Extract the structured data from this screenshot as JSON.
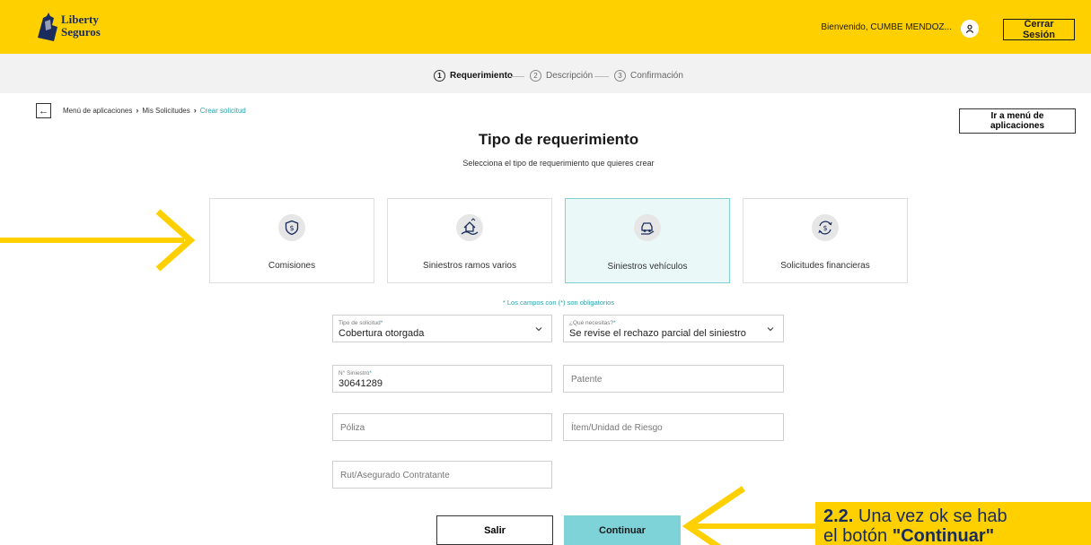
{
  "header": {
    "logo_line1": "Liberty",
    "logo_line2": "Seguros",
    "welcome": "Bienvenido, CUMBE MENDOZ...",
    "logout": "Cerrar Sesión"
  },
  "stepper": [
    {
      "num": "1",
      "label": "Requerimiento"
    },
    {
      "num": "2",
      "label": "Descripción"
    },
    {
      "num": "3",
      "label": "Confirmación"
    }
  ],
  "breadcrumb": {
    "back": "←",
    "items": [
      "Menú de aplicaciones",
      "Mis Solicitudes",
      "Crear solicitud"
    ],
    "sep": "›"
  },
  "goto_button": "Ir a menú de aplicaciones",
  "page": {
    "title": "Tipo de requerimiento",
    "subtitle": "Selecciona el tipo de requerimiento que quieres crear"
  },
  "cards": [
    {
      "label": "Comisiones",
      "icon": "shield-dollar-icon"
    },
    {
      "label": "Siniestros ramos varios",
      "icon": "house-hand-icon"
    },
    {
      "label": "Siniestros vehículos",
      "icon": "car-hand-icon"
    },
    {
      "label": "Solicitudes financieras",
      "icon": "dollar-cycle-icon"
    }
  ],
  "required_note": "* Los campos con (*) son obligatorios",
  "form": {
    "tipo_solicitud": {
      "label": "Tipo de solicitud",
      "ast": "*",
      "value": "Cobertura otorgada"
    },
    "que_necesitas": {
      "label": "¿Qué necesitas?",
      "ast": "*",
      "value": "Se revise el rechazo parcial del siniestro"
    },
    "siniestro": {
      "label": "N° Siniestro",
      "ast": "*",
      "value": "30641289"
    },
    "patente": {
      "placeholder": "Patente"
    },
    "poliza": {
      "placeholder": "Póliza"
    },
    "item": {
      "placeholder": "Ítem/Unidad de Riesgo"
    },
    "rut": {
      "placeholder": "Rut/Asegurado Contratante"
    }
  },
  "buttons": {
    "exit": "Salir",
    "continue": "Continuar"
  },
  "annotation": {
    "num": "2.2.",
    "line1": " Una vez ok se hab",
    "line2_prefix": "el botón ",
    "line2_bold": "\"Continuar\""
  },
  "colors": {
    "brand_yellow": "#FFD000",
    "accent_teal": "#7ed3d8",
    "selected_bg": "#eaf8f8"
  }
}
